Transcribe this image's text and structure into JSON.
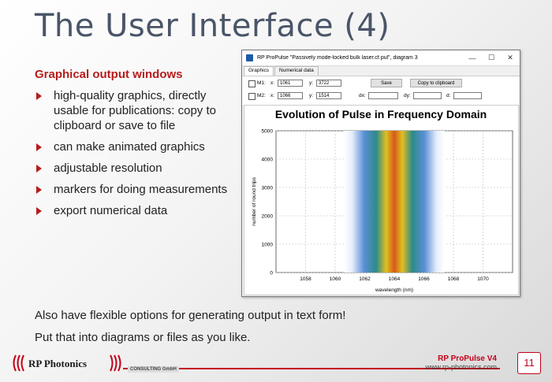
{
  "slide": {
    "title": "The User Interface (4)",
    "section_heading": "Graphical output windows",
    "bullets": [
      "high-quality graphics, directly usable for publications: copy to clipboard or save to file",
      "can make animated graphics",
      "adjustable resolution",
      "markers for doing measurements",
      "export numerical data"
    ],
    "bottom_text_1": "Also have flexible options for generating output in text form!",
    "bottom_text_2": "Put that into diagrams or files as you like."
  },
  "window": {
    "title": "RP ProPulse \"Passively mode-locked bulk laser.cf.pul\", diagram 3",
    "minimize": "—",
    "maximize": "☐",
    "close": "✕",
    "tabs": [
      "Graphics",
      "Numerical data"
    ],
    "m1_label": "M1:",
    "m2_label": "M2:",
    "x_label": "x:",
    "y_label": "y:",
    "m1_x": "1061",
    "m1_y": "3722",
    "m2_x": "1066",
    "m2_y": "1514",
    "dx_label": "dx:",
    "dy_label": "dy:",
    "d_label": "d:",
    "dx": "",
    "dy": "",
    "d": "",
    "save_label": "Save",
    "copy_label": "Copy to clipboard"
  },
  "chart_data": {
    "type": "heatmap",
    "title": "Evolution of Pulse in Frequency Domain",
    "xlabel": "wavelength (nm)",
    "ylabel": "number of round trips",
    "xlim": [
      1056,
      1072
    ],
    "ylim": [
      0,
      5000
    ],
    "xticks": [
      1058,
      1060,
      1062,
      1064,
      1066,
      1068,
      1070
    ],
    "yticks": [
      0,
      1000,
      2000,
      3000,
      4000,
      5000
    ],
    "grid": true,
    "center_wavelength": 1064,
    "colors": {
      "low": "#ffffff",
      "mid": "#4a7fd0",
      "high": "#d62c1a"
    }
  },
  "footer": {
    "company": "RP Photonics",
    "consulting": "CONSULTING GmbH",
    "product": "RP ProPulse V4",
    "url": "www.rp-photonics.com",
    "page": "11"
  }
}
